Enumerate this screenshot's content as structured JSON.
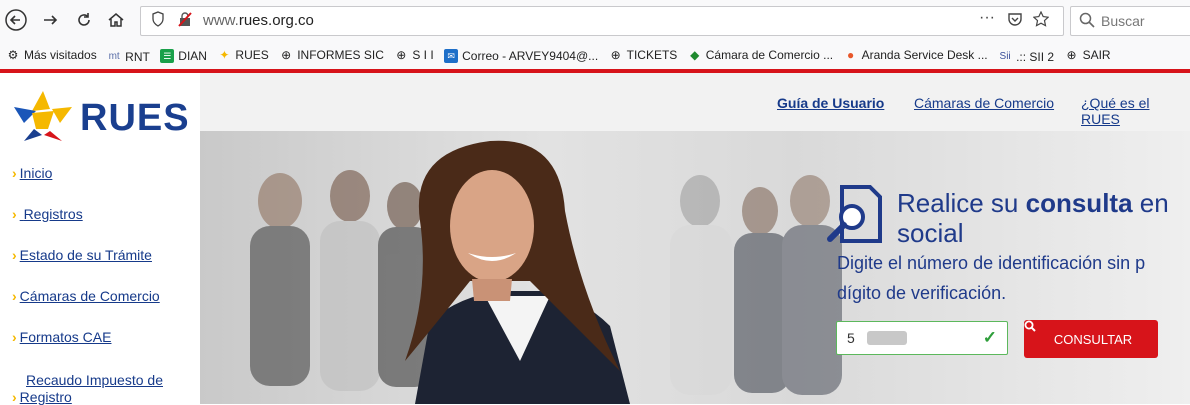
{
  "browser": {
    "url_prefix": "www.",
    "url_domain": "rues.org.co",
    "search_placeholder": "Buscar",
    "page_actions": "···",
    "bookmarks": [
      "Más visitados",
      "RNT",
      "DIAN",
      "RUES",
      "INFORMES SIC",
      "S I I",
      "Correo - ARVEY9404@...",
      "TICKETS",
      "Cámara de Comercio ...",
      "Aranda Service Desk ...",
      ".:: SII 2",
      "SAIR"
    ]
  },
  "site": {
    "logo_text": "RUES",
    "sidebar": [
      "Inicio",
      "Registros",
      "Estado de su Trámite",
      "Cámaras de Comercio",
      "Formatos CAE",
      "Recaudo Impuesto de",
      "Registro"
    ],
    "topnav": [
      "Guía de Usuario",
      "Cámaras de Comercio",
      "¿Qué es el RUES"
    ],
    "hero": {
      "title_pre": "Realice su ",
      "title_bold": "consulta",
      "title_post": " en",
      "title_line2": "social",
      "subtitle_line1": "Digite el número de identificación sin p",
      "subtitle_line2": "dígito de verificación.",
      "input_value": "5",
      "button_label": "CONSULTAR"
    }
  },
  "colors": {
    "brand_blue": "#1a3f8f",
    "brand_red": "#d7141a",
    "brand_yellow": "#f5b800"
  }
}
